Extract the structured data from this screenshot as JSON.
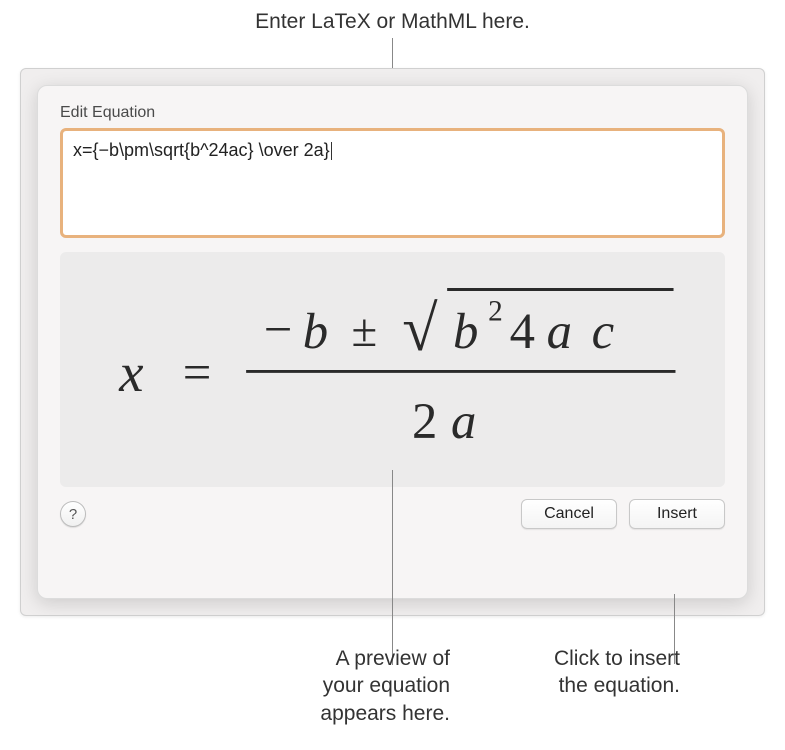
{
  "callouts": {
    "top": "Enter LaTeX or MathML here.",
    "preview": "A preview of\nyour equation\nappears here.",
    "insert": "Click to insert\nthe equation."
  },
  "dialog": {
    "title": "Edit Equation",
    "input_value": "x={−b\\pm\\sqrt{b^24ac} \\over 2a}",
    "help_label": "?",
    "cancel_label": "Cancel",
    "insert_label": "Insert"
  },
  "equation_preview": {
    "latex": "x = \\frac{-b \\pm \\sqrt{b^{2}4ac}}{2a}",
    "display": {
      "lhs": "x",
      "eq": "=",
      "numerator": "−b ± √(b²4ac)",
      "denominator": "2a"
    }
  }
}
